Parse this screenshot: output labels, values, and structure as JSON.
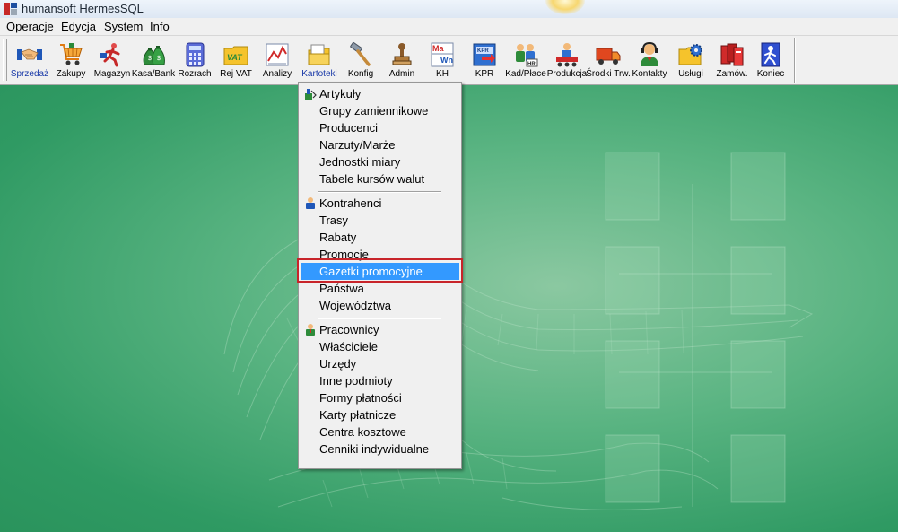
{
  "window": {
    "title": "humansoft HermesSQL"
  },
  "menubar": {
    "items": [
      {
        "label": "Operacje"
      },
      {
        "label": "Edycja"
      },
      {
        "label": "System"
      },
      {
        "label": "Info"
      }
    ]
  },
  "toolbar": {
    "buttons": [
      {
        "label": "Sprzedaż",
        "icon": "handshake-icon"
      },
      {
        "label": "Zakupy",
        "icon": "shopping-cart-icon"
      },
      {
        "label": "Magazyn",
        "icon": "running-man-icon"
      },
      {
        "label": "Kasa/Bank",
        "icon": "money-bags-icon"
      },
      {
        "label": "Rozrach",
        "icon": "calculator-icon"
      },
      {
        "label": "Rej VAT",
        "icon": "vat-folder-icon"
      },
      {
        "label": "Analizy",
        "icon": "line-chart-icon"
      },
      {
        "label": "Kartoteki",
        "icon": "folders-icon"
      },
      {
        "label": "Konfig",
        "icon": "hammer-icon"
      },
      {
        "label": "Admin",
        "icon": "stamp-icon"
      },
      {
        "label": "KH",
        "icon": "ma-wn-ledger-icon"
      },
      {
        "label": "KPR",
        "icon": "kpr-book-icon"
      },
      {
        "label": "Kad/Płace",
        "icon": "staff-hr-icon"
      },
      {
        "label": "Produkcja",
        "icon": "production-icon"
      },
      {
        "label": "Środki Trw.",
        "icon": "truck-icon"
      },
      {
        "label": "Kontakty",
        "icon": "headset-person-icon"
      },
      {
        "label": "Usługi",
        "icon": "gear-folder-icon"
      },
      {
        "label": "Zamów.",
        "icon": "order-books-icon"
      },
      {
        "label": "Koniec",
        "icon": "exit-door-icon"
      }
    ]
  },
  "popup_menu": {
    "groups": [
      {
        "items": [
          {
            "label": "Artykuły",
            "icon": "article-icon"
          },
          {
            "label": "Grupy zamiennikowe"
          },
          {
            "label": "Producenci"
          },
          {
            "label": "Narzuty/Marże"
          },
          {
            "label": "Jednostki miary"
          },
          {
            "label": "Tabele kursów walut"
          }
        ]
      },
      {
        "items": [
          {
            "label": "Kontrahenci",
            "icon": "contractor-icon"
          },
          {
            "label": "Trasy"
          },
          {
            "label": "Rabaty"
          },
          {
            "label": "Promocje"
          },
          {
            "label": "Gazetki promocyjne",
            "highlighted": true
          },
          {
            "label": "Państwa"
          },
          {
            "label": "Województwa"
          }
        ]
      },
      {
        "items": [
          {
            "label": "Pracownicy",
            "icon": "employee-icon"
          },
          {
            "label": "Właściciele"
          },
          {
            "label": "Urzędy"
          },
          {
            "label": "Inne podmioty"
          },
          {
            "label": "Formy płatności"
          },
          {
            "label": "Karty płatnicze"
          },
          {
            "label": "Centra kosztowe"
          },
          {
            "label": "Cenniki indywidualne"
          }
        ]
      }
    ]
  },
  "colors": {
    "background_green": "#2f9a63",
    "menu_highlight": "#3399ff",
    "annotation_red": "#c8242a"
  }
}
